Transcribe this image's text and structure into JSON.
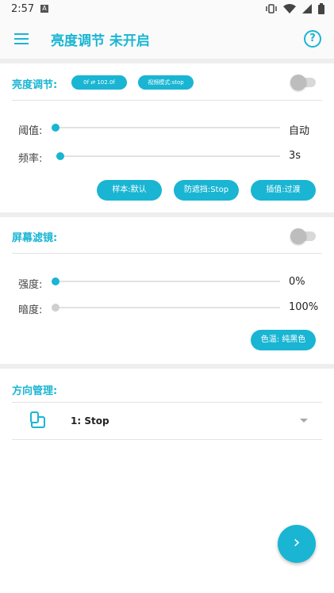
{
  "status_bar": {
    "time": "2:57",
    "notification_letter": "A"
  },
  "app_bar": {
    "title": "亮度调节 未开启",
    "help_glyph": "?"
  },
  "brightness": {
    "title": "亮度调节:",
    "range_badge": "0f ⇄ 102.0f",
    "mode_badge": "视频模式:stop",
    "toggle_on": false,
    "threshold": {
      "label": "阈值:",
      "value": "自动"
    },
    "frequency": {
      "label": "频率:",
      "value": "3s"
    },
    "buttons": {
      "sample": "样本:默认",
      "anti_block": "防遮挡:Stop",
      "interp": "插值:过渡"
    }
  },
  "filter": {
    "title": "屏幕滤镜:",
    "toggle_on": false,
    "intensity": {
      "label": "强度:",
      "value": "0%"
    },
    "darkness": {
      "label": "暗度:",
      "value": "100%"
    },
    "color_temp": "色温: 纯黑色"
  },
  "orientation": {
    "title": "方向管理:",
    "selected": "1: Stop"
  },
  "icons": {
    "menu": "menu-icon",
    "help": "help-icon",
    "fab": "chevron-right-icon",
    "orientation": "screen-rotation-icon"
  },
  "colors": {
    "accent": "#19b5d3",
    "divider": "#eeeeee"
  }
}
